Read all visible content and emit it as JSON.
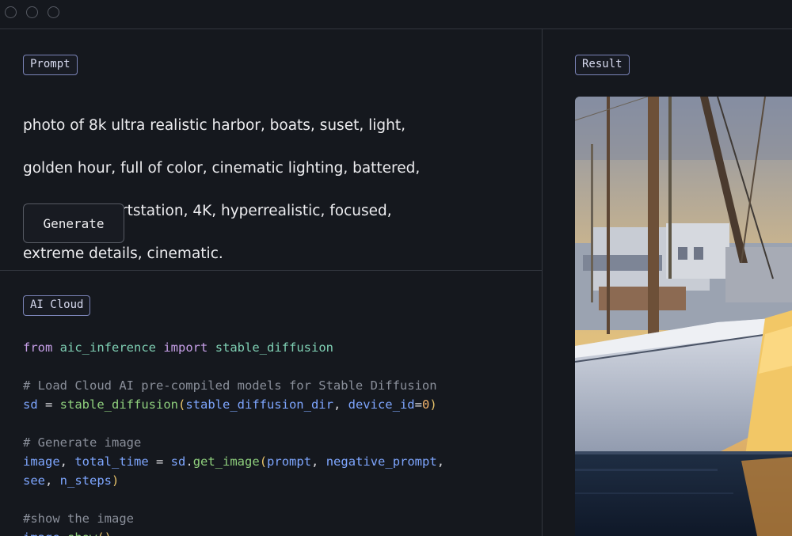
{
  "window": {
    "controls": [
      "close",
      "minimize",
      "maximize"
    ]
  },
  "prompt_panel": {
    "tag_label": "Prompt",
    "prompt_lines": [
      "photo of 8k ultra realistic harbor, boats, suset, light,",
      "golden hour, full of color, cinematic lighting, battered,",
      "trending on artstation, 4K, hyperrealistic, focused,",
      "extreme details, cinematic."
    ],
    "generate_label": "Generate"
  },
  "code_panel": {
    "tag_label": "AI Cloud",
    "lines": [
      [
        [
          "kw",
          "from"
        ],
        [
          "op",
          " "
        ],
        [
          "id",
          "aic_inference"
        ],
        [
          "op",
          " "
        ],
        [
          "kw",
          "import"
        ],
        [
          "op",
          " "
        ],
        [
          "id",
          "stable_diffusion"
        ]
      ],
      [],
      [
        [
          "cm",
          "# Load Cloud AI pre-compiled models for Stable Diffusion"
        ]
      ],
      [
        [
          "var",
          "sd"
        ],
        [
          "op",
          " = "
        ],
        [
          "fn",
          "stable_diffusion"
        ],
        [
          "pr",
          "("
        ],
        [
          "pm",
          "stable_diffusion_dir"
        ],
        [
          "op",
          ", "
        ],
        [
          "pm",
          "device_id"
        ],
        [
          "op",
          "="
        ],
        [
          "num",
          "0"
        ],
        [
          "pr",
          ")"
        ]
      ],
      [],
      [
        [
          "cm",
          "# Generate image"
        ]
      ],
      [
        [
          "var",
          "image"
        ],
        [
          "op",
          ", "
        ],
        [
          "var",
          "total_time"
        ],
        [
          "op",
          " = "
        ],
        [
          "var",
          "sd"
        ],
        [
          "op",
          "."
        ],
        [
          "fn",
          "get_image"
        ],
        [
          "pr",
          "("
        ],
        [
          "pm",
          "prompt"
        ],
        [
          "op",
          ", "
        ],
        [
          "pm",
          "negative_prompt"
        ],
        [
          "op",
          ","
        ]
      ],
      [
        [
          "pm",
          "see"
        ],
        [
          "op",
          ", "
        ],
        [
          "pm",
          "n_steps"
        ],
        [
          "pr",
          ")"
        ]
      ],
      [],
      [
        [
          "cm",
          "#show the image"
        ]
      ],
      [
        [
          "var",
          "image"
        ],
        [
          "op",
          "."
        ],
        [
          "fn",
          "show"
        ],
        [
          "pr",
          "()"
        ]
      ]
    ]
  },
  "result_panel": {
    "tag_label": "Result",
    "image_alt": "harbor sunset boats"
  },
  "colors": {
    "background": "#15181e",
    "tag_border": "#7b84b8",
    "divider": "#33373f"
  }
}
